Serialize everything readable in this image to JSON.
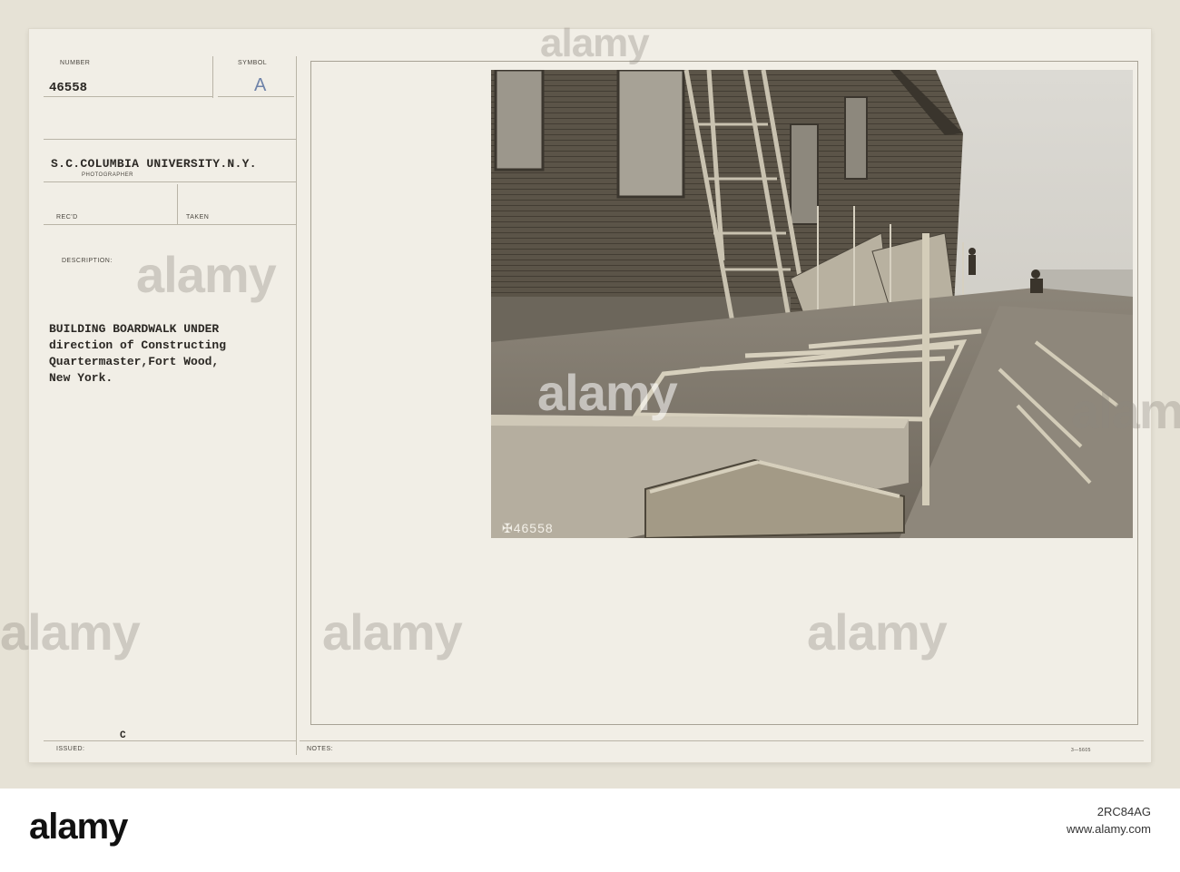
{
  "card": {
    "number_label": "NUMBER",
    "number_value": "46558",
    "symbol_label": "SYMBOL",
    "symbol_value": "A",
    "photographer_value": "S.C.COLUMBIA UNIVERSITY.N.Y.",
    "photographer_label": "PHOTOGRAPHER",
    "recd_label": "REC'D",
    "taken_label": "TAKEN",
    "description_label": "DESCRIPTION:",
    "description_lines": [
      "BUILDING BOARDWALK UNDER",
      "direction of Constructing",
      "Quartermaster,Fort Wood,",
      "New York."
    ],
    "issued_label": "ISSUED:",
    "issued_value": "C",
    "notes_label": "NOTES:",
    "form_code": "3—5605"
  },
  "photo": {
    "negative_number": "46558",
    "description": "Wooden barracks building with stairs and scaffolding; boardwalk frame under construction in foreground"
  },
  "watermarks": [
    "alamy",
    "alamy",
    "alamy",
    "alamy",
    "alamy",
    "alamy",
    "alamy"
  ],
  "stock_bar": {
    "logo_text": "alamy",
    "image_id": "2RC84AG",
    "url": "www.alamy.com"
  }
}
